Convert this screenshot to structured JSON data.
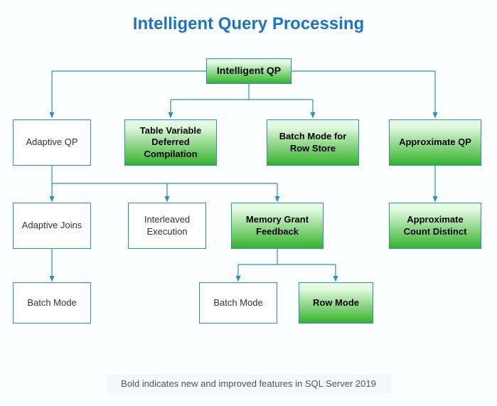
{
  "title": "Intelligent Query Processing",
  "footer": "Bold indicates new and improved features in SQL Server 2019",
  "nodes": {
    "root": "Intelligent QP",
    "adaptiveQP": "Adaptive QP",
    "tableVar": "Table Variable Deferred Compilation",
    "batchRowStore": "Batch Mode for Row Store",
    "approxQP": "Approximate QP",
    "adaptiveJoins": "Adaptive Joins",
    "interleaved": "Interleaved Execution",
    "memGrant": "Memory Grant Feedback",
    "approxCount": "Approximate Count Distinct",
    "batchMode1": "Batch Mode",
    "batchMode2": "Batch Mode",
    "rowMode": "Row Mode"
  }
}
